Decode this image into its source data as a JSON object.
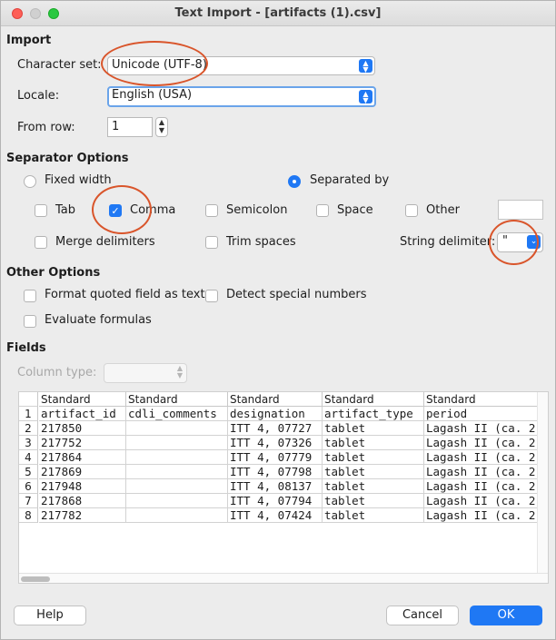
{
  "window": {
    "title": "Text Import - [artifacts (1).csv]"
  },
  "import": {
    "section": "Import",
    "charset_label": "Character set:",
    "charset_value": "Unicode (UTF-8)",
    "locale_label": "Locale:",
    "locale_value": "English (USA)",
    "from_row_label": "From row:",
    "from_row_value": "1"
  },
  "separator": {
    "section": "Separator Options",
    "fixed_width": "Fixed width",
    "separated_by": "Separated by",
    "tab": "Tab",
    "comma": "Comma",
    "semicolon": "Semicolon",
    "space": "Space",
    "other": "Other",
    "merge_delimiters": "Merge delimiters",
    "trim_spaces": "Trim spaces",
    "string_delimiter_label": "String delimiter:",
    "string_delimiter_value": "\"",
    "state": {
      "fixed_width": false,
      "separated_by": true,
      "tab": false,
      "comma": true,
      "semicolon": false,
      "space": false,
      "other": false,
      "merge_delimiters": false,
      "trim_spaces": false
    }
  },
  "other_options": {
    "section": "Other Options",
    "format_quoted": "Format quoted field as text",
    "detect_special": "Detect special numbers",
    "evaluate_formulas": "Evaluate formulas",
    "state": {
      "format_quoted": false,
      "detect_special": false,
      "evaluate_formulas": false
    }
  },
  "fields": {
    "section": "Fields",
    "column_type_label": "Column type:",
    "column_type_value": "",
    "column_headers": [
      "Standard",
      "Standard",
      "Standard",
      "Standard",
      "Standard"
    ],
    "row_numbers": [
      "1",
      "2",
      "3",
      "4",
      "5",
      "6",
      "7",
      "8"
    ],
    "rows": [
      [
        "artifact_id",
        "cdli_comments",
        "designation",
        "artifact_type",
        "period"
      ],
      [
        "217850",
        "",
        "ITT 4, 07727",
        "tablet",
        "Lagash II (ca. 2"
      ],
      [
        "217752",
        "",
        "ITT 4, 07326",
        "tablet",
        "Lagash II (ca. 2"
      ],
      [
        "217864",
        "",
        "ITT 4, 07779",
        "tablet",
        "Lagash II (ca. 2"
      ],
      [
        "217869",
        "",
        "ITT 4, 07798",
        "tablet",
        "Lagash II (ca. 2"
      ],
      [
        "217948",
        "",
        "ITT 4, 08137",
        "tablet",
        "Lagash II (ca. 2"
      ],
      [
        "217868",
        "",
        "ITT 4, 07794",
        "tablet",
        "Lagash II (ca. 2"
      ],
      [
        "217782",
        "",
        "ITT 4, 07424",
        "tablet",
        "Lagash II (ca. 2"
      ]
    ]
  },
  "buttons": {
    "help": "Help",
    "cancel": "Cancel",
    "ok": "OK"
  },
  "colors": {
    "accent": "#1f78f4",
    "annotation": "#d9552b"
  }
}
